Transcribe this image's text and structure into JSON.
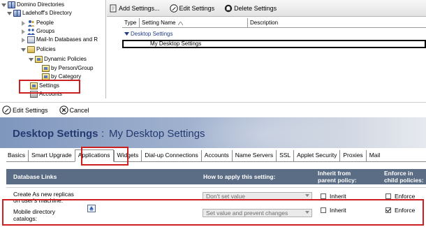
{
  "tree": {
    "items": [
      {
        "label": "Domino Directories"
      },
      {
        "label": "Ladehoff's Directory"
      },
      {
        "label": "People"
      },
      {
        "label": "Groups"
      },
      {
        "label": "Mail-In Databases and R"
      },
      {
        "label": "Policies"
      },
      {
        "label": "Dynamic Policies"
      },
      {
        "label": "by Person/Group"
      },
      {
        "label": "by Category"
      },
      {
        "label": "Settings"
      },
      {
        "label": "Accounts"
      }
    ]
  },
  "view_actions": {
    "add_settings": "Add Settings...",
    "edit_settings": "Edit Settings",
    "delete_settings": "Delete Settings"
  },
  "view_columns": {
    "type": "Type",
    "setting_name": "Setting Name",
    "description": "Description"
  },
  "view_rows": {
    "category": "Desktop Settings",
    "document": "My Desktop Settings"
  },
  "document_actions": {
    "edit_settings": "Edit Settings",
    "cancel": "Cancel"
  },
  "banner": {
    "title": "Desktop Settings",
    "separator": ":",
    "subtitle": "My Desktop Settings"
  },
  "tabs": [
    "Basics",
    "Smart Upgrade",
    "Applications",
    "Widgets",
    "Dial-up Connections",
    "Accounts",
    "Name Servers",
    "SSL",
    "Applet Security",
    "Proxies",
    "Mail"
  ],
  "active_tab": "Applications",
  "grid_headers": {
    "database_links": "Database Links",
    "how_to_apply": "How to apply this setting:",
    "inherit_line1": "Inherit from",
    "inherit_line2": "parent policy:",
    "enforce_line1": "Enforce in",
    "enforce_line2": "child policies:"
  },
  "grid_rows": [
    {
      "label_line1": "Create As new replicas",
      "label_line2": "on user's machine:",
      "apply_value": "Don't set value",
      "inherit_label": "Inherit",
      "inherit_checked": false,
      "enforce_label": "Enforce",
      "enforce_checked": false
    },
    {
      "label_line1": "Mobile directory",
      "label_line2": "catalogs:",
      "apply_value": "Set value and prevent changes",
      "inherit_label": "Inherit",
      "inherit_checked": false,
      "enforce_label": "Enforce",
      "enforce_checked": true
    }
  ],
  "colors": {
    "highlight_red": "#cc1f1f",
    "banner_title": "#243a70",
    "grid_header_bg": "#5b6d84",
    "category_text": "#233c86"
  }
}
